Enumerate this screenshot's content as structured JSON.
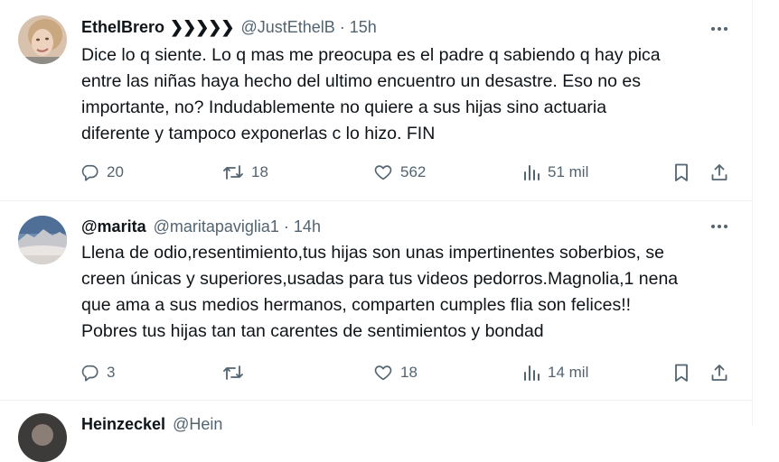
{
  "colors": {
    "text": "#0f1419",
    "muted": "#536471",
    "divider": "#eff3f4"
  },
  "tweets": [
    {
      "name": "EthelBrero",
      "name_deco": "❯❯❯❯❯",
      "handle": "@JustEthelB",
      "separator": "·",
      "time": "15h",
      "avatar_icon": "avatar-woman-photo",
      "lines": [
        "Dice lo q siente. Lo q mas me preocupa es el padre q sabiendo q hay pica",
        "entre las niñas haya hecho del ultimo encuentro un desastre. Eso no es",
        "importante, no? Indudablemente no quiere a sus hijas sino actuaria",
        "diferente y tampoco exponerlas c lo hizo. FIN"
      ],
      "replies": "20",
      "retweets": "18",
      "likes": "562",
      "views": "51 mil"
    },
    {
      "name": "@marita",
      "handle": "@maritapaviglia1",
      "separator": "·",
      "time": "14h",
      "avatar_icon": "avatar-landscape-photo",
      "lines": [
        "Llena de odio,resentimiento,tus hijas son unas impertinentes soberbios, se",
        "creen únicas y superiores,usadas para tus videos pedorros.Magnolia,1 nena",
        "que ama a sus medios hermanos, comparten  cumples flia son felices!!",
        "Pobres tus hijas tan tan carentes de sentimientos y bondad"
      ],
      "replies": "3",
      "retweets": "",
      "likes": "18",
      "views": "14 mil"
    },
    {
      "name": "Heinzeckel",
      "handle": "@Hein",
      "avatar_icon": "avatar-photo"
    }
  ]
}
